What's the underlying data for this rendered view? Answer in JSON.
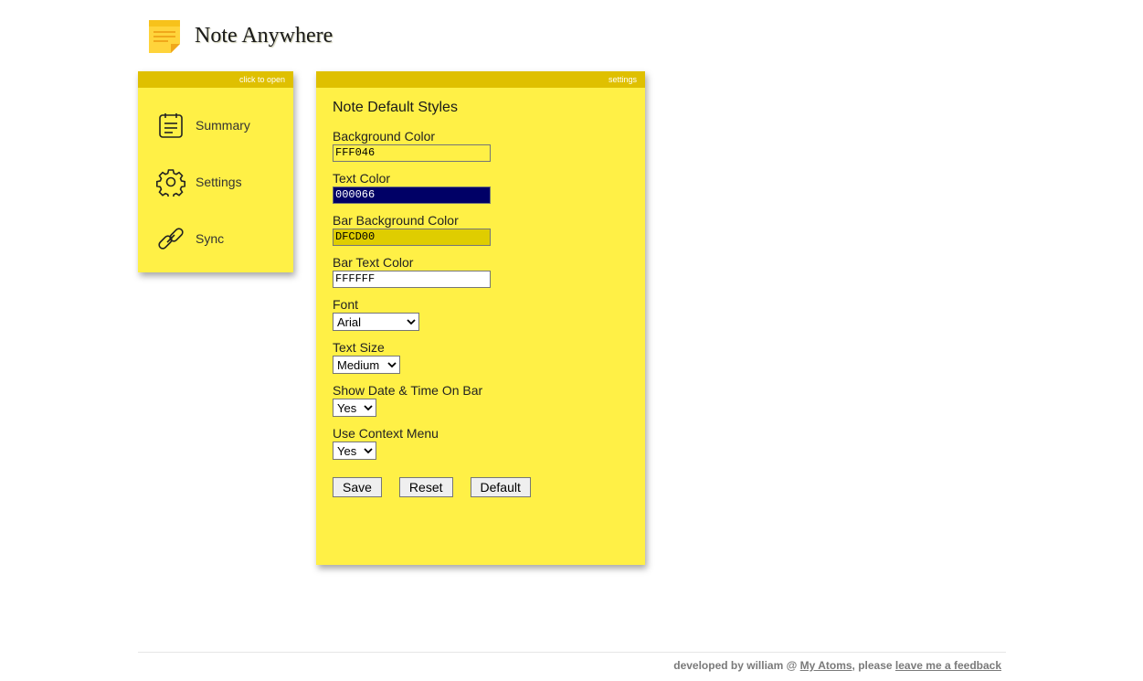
{
  "header": {
    "title": "Note Anywhere",
    "logo_icon": "sticky-note-icon"
  },
  "menu_note": {
    "bar_text": "click to open",
    "items": [
      {
        "label": "Summary",
        "icon": "clipboard-icon"
      },
      {
        "label": "Settings",
        "icon": "gear-icon"
      },
      {
        "label": "Sync",
        "icon": "link-icon"
      }
    ]
  },
  "settings_note": {
    "bar_text": "settings",
    "section_title": "Note Default Styles",
    "fields": {
      "background_color": {
        "label": "Background Color",
        "value": "FFF046"
      },
      "text_color": {
        "label": "Text Color",
        "value": "000066"
      },
      "bar_background_color": {
        "label": "Bar Background Color",
        "value": "DFCD00"
      },
      "bar_text_color": {
        "label": "Bar Text Color",
        "value": "FFFFFF"
      },
      "font": {
        "label": "Font",
        "value": "Arial"
      },
      "text_size": {
        "label": "Text Size",
        "value": "Medium"
      },
      "show_date_time": {
        "label": "Show Date & Time On Bar",
        "value": "Yes"
      },
      "use_context_menu": {
        "label": "Use Context Menu",
        "value": "Yes"
      }
    },
    "buttons": {
      "save": "Save",
      "reset": "Reset",
      "default": "Default"
    }
  },
  "footer": {
    "prefix": "developed by william @ ",
    "link1": "My Atoms",
    "middle": ", please ",
    "link2": "leave me a feedback"
  },
  "colors": {
    "note_background": "#FFF046",
    "note_bar": "#DFC000",
    "text_color_swatch": "#000066",
    "bar_bg_swatch": "#DFCD00",
    "bar_text_swatch": "#FFFFFF"
  }
}
